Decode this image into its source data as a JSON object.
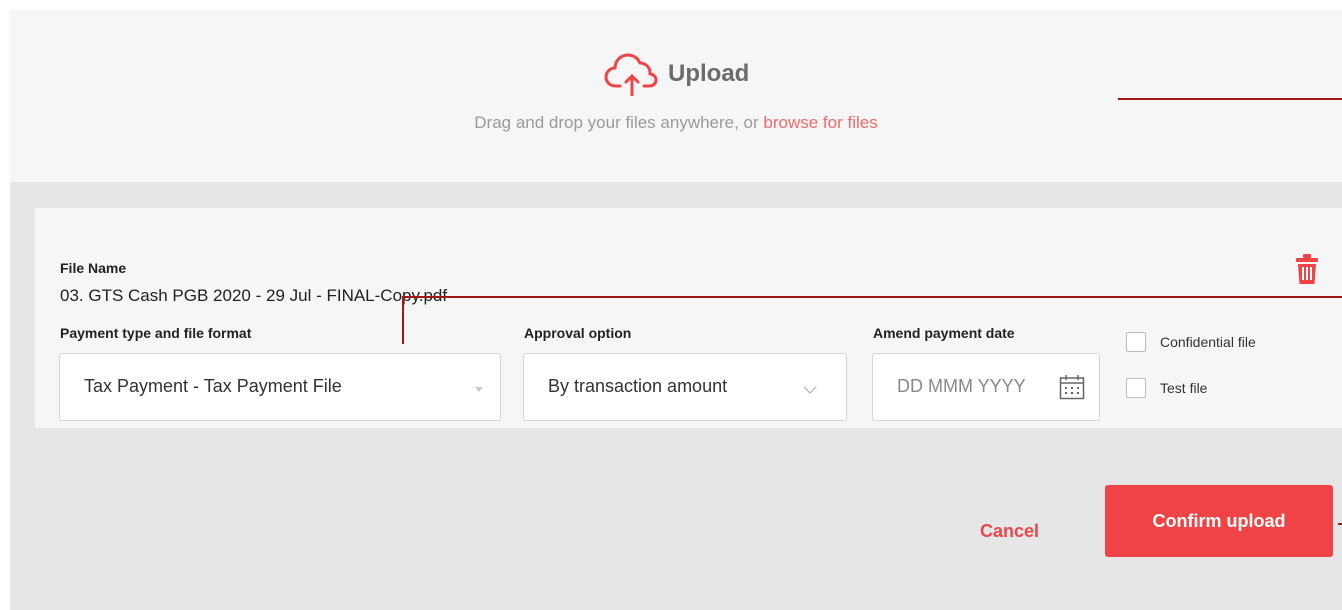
{
  "upload": {
    "title": "Upload",
    "instruction": "Drag and drop your files anywhere, or ",
    "browse_link": "browse for files",
    "icon": "cloud-upload-icon"
  },
  "file": {
    "name_label": "File Name",
    "name_value": "03. GTS Cash PGB 2020 - 29 Jul - FINAL-Copy.pdf",
    "delete_icon": "trash-icon"
  },
  "payment_type": {
    "label": "Payment type and file format",
    "value": "Tax Payment - Tax Payment File"
  },
  "approval": {
    "label": "Approval option",
    "value": "By transaction amount"
  },
  "payment_date": {
    "label": "Amend payment date",
    "placeholder": "DD MMM YYYY",
    "icon": "calendar-icon"
  },
  "options": {
    "confidential": {
      "label": "Confidential file",
      "checked": false
    },
    "test": {
      "label": "Test file",
      "checked": false
    }
  },
  "actions": {
    "cancel_label": "Cancel",
    "confirm_label": "Confirm upload"
  },
  "colors": {
    "accent": "#ef4346",
    "link": "#ee6b6b",
    "annotation": "#a01818"
  }
}
